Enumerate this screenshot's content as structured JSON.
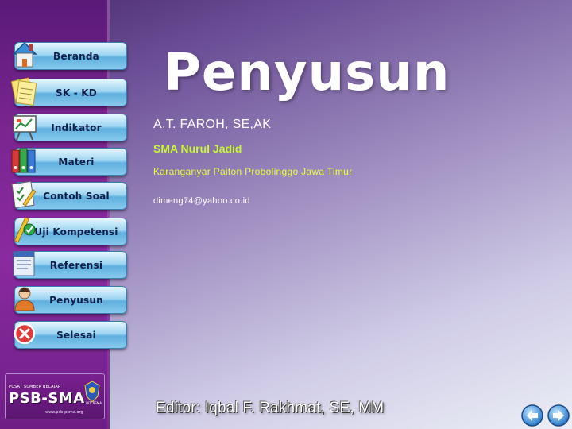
{
  "menu": {
    "items": [
      {
        "label": "Beranda",
        "icon": "home-icon"
      },
      {
        "label": "SK - KD",
        "icon": "notes-icon"
      },
      {
        "label": "Indikator",
        "icon": "presentation-board-icon"
      },
      {
        "label": "Materi",
        "icon": "binders-icon"
      },
      {
        "label": "Contoh Soal",
        "icon": "checklist-icon"
      },
      {
        "label": "Uji Kompetensi",
        "icon": "pencil-check-icon"
      },
      {
        "label": "Referensi",
        "icon": "document-icon"
      },
      {
        "label": "Penyusun",
        "icon": "person-icon"
      },
      {
        "label": "Selesai",
        "icon": "close-icon"
      }
    ]
  },
  "main": {
    "title": "Penyusun",
    "author_name": "A.T. FAROH, SE,AK",
    "school": "SMA Nurul Jadid",
    "address": "Karanganyar Paiton Probolinggo Jawa Timur",
    "email": "dimeng74@yahoo.co.id",
    "editor": "Editor: Iqbal F. Rakhmat, SE, MM"
  },
  "logo": {
    "top_text": "PUSAT SUMBER BELAJAR",
    "main_text": "PSB-SMA",
    "url_text": "www.psb-psma.org",
    "emblem_text": "DIT. PSMA"
  },
  "nav": {
    "prev_icon": "arrow-left-icon",
    "next_icon": "arrow-right-icon"
  },
  "colors": {
    "title": "#ffffff",
    "school": "#c8f53a",
    "address": "#e6ff3a",
    "button_top": "#e6f6ff",
    "button_bottom": "#5fb0e0",
    "sidebar": "#7a2590"
  }
}
